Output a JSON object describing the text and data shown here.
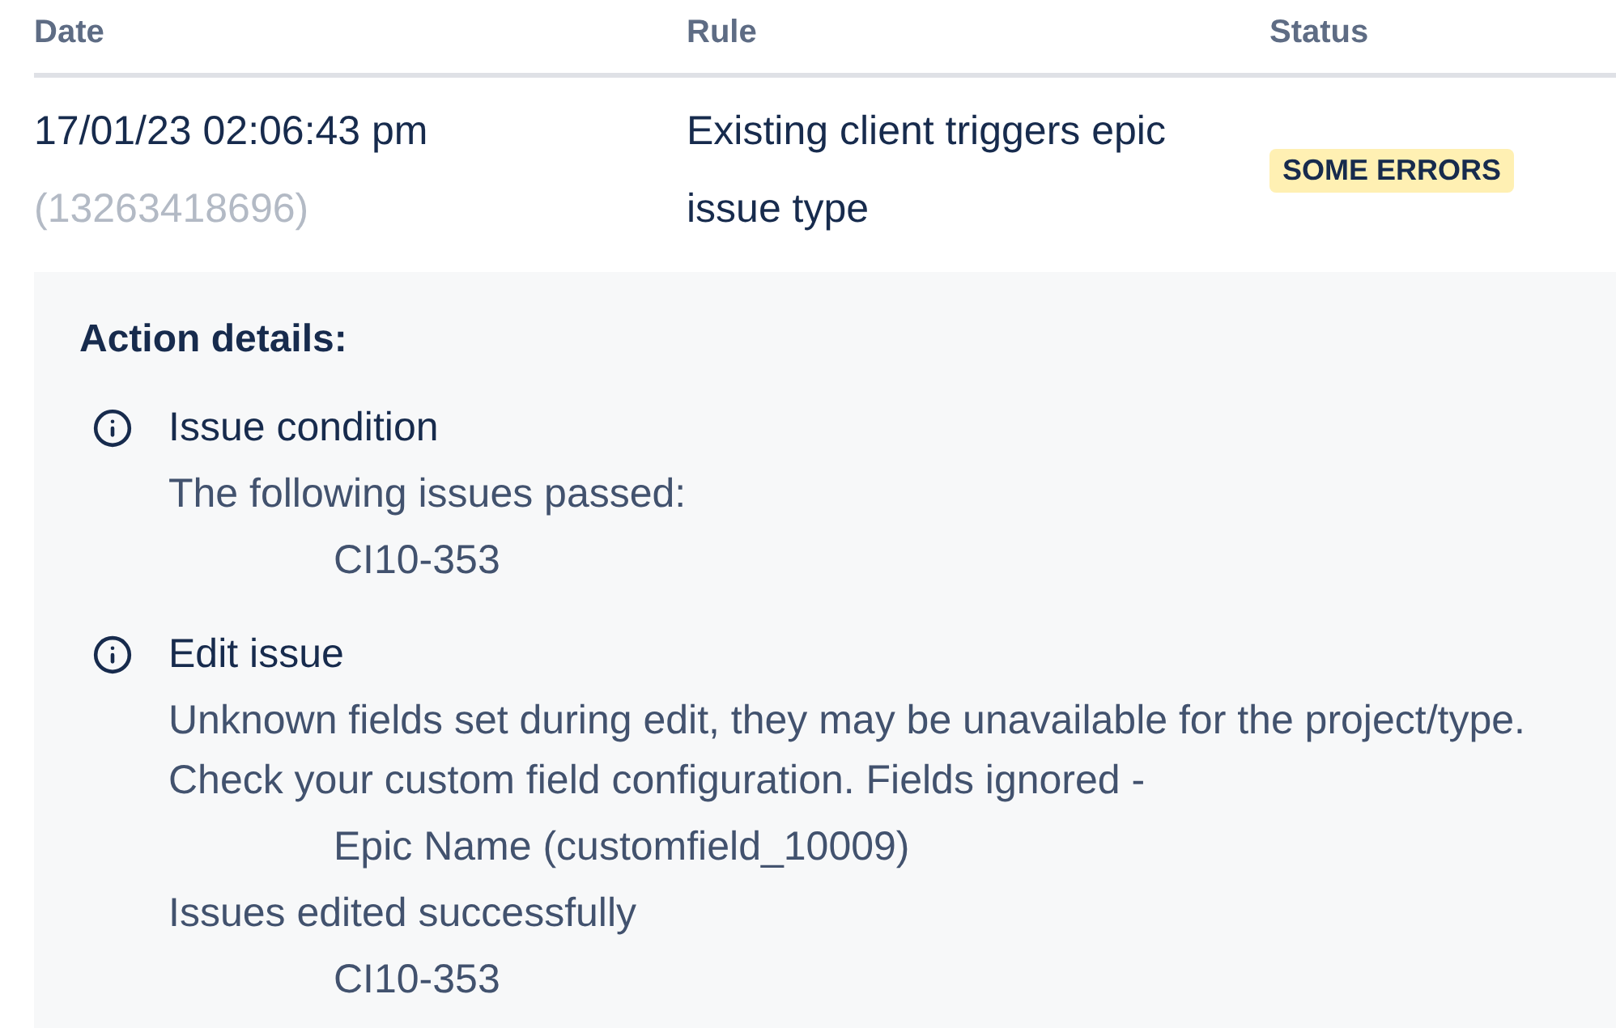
{
  "table": {
    "columns": [
      "Date",
      "Rule",
      "Status"
    ],
    "rows": [
      {
        "date": "17/01/23 02:06:43 pm",
        "execution_id": "(13263418696)",
        "rule": "Existing client triggers epic issue type",
        "status": {
          "label": "SOME ERRORS",
          "kind": "warning"
        },
        "details": {
          "heading": "Action details:",
          "actions": [
            {
              "title": "Issue condition",
              "lines": [
                {
                  "kind": "message",
                  "text": "The following issues passed:"
                },
                {
                  "kind": "item",
                  "text": "CI10-353"
                }
              ]
            },
            {
              "title": "Edit issue",
              "lines": [
                {
                  "kind": "message",
                  "text": "Unknown fields set during edit, they may be unavailable for the project/type. Check your custom field configuration. Fields ignored -"
                },
                {
                  "kind": "item",
                  "text": "Epic Name (customfield_10009)"
                },
                {
                  "kind": "message",
                  "text": "Issues edited successfully"
                },
                {
                  "kind": "item",
                  "text": "CI10-353"
                }
              ]
            }
          ]
        }
      }
    ]
  }
}
